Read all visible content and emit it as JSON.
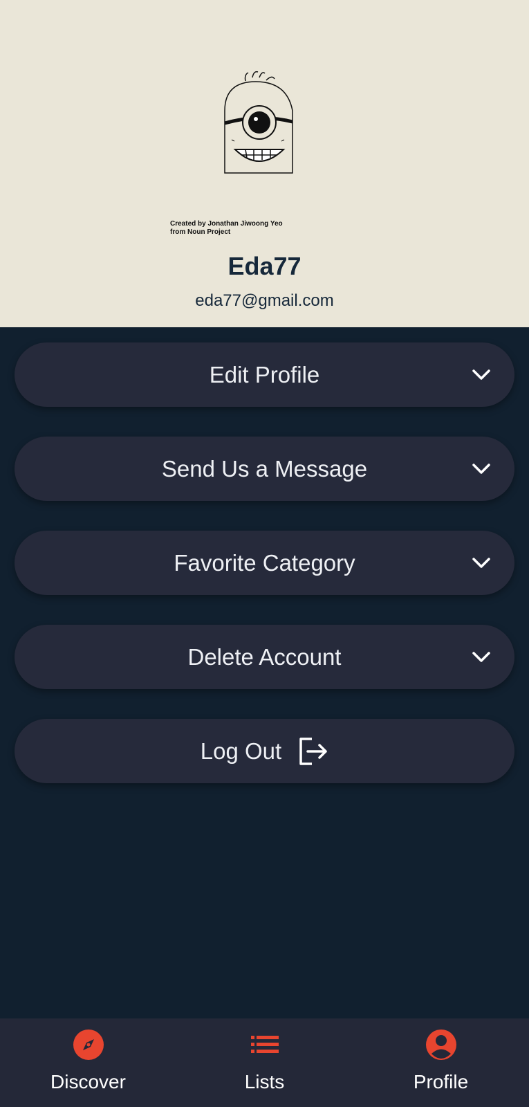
{
  "profile": {
    "credit_line1": "Created by Jonathan Jiwoong Yeo",
    "credit_line2": "from Noun Project",
    "username": "Eda77",
    "email": "eda77@gmail.com"
  },
  "menu": {
    "edit_profile": "Edit Profile",
    "send_message": "Send Us a Message",
    "favorite_category": "Favorite Category",
    "delete_account": "Delete Account",
    "log_out": "Log Out"
  },
  "nav": {
    "discover": "Discover",
    "lists": "Lists",
    "profile": "Profile"
  },
  "colors": {
    "accent": "#e8452f",
    "header_bg": "#eae6d8",
    "page_bg": "#11202f",
    "card_bg": "#262a3b"
  }
}
